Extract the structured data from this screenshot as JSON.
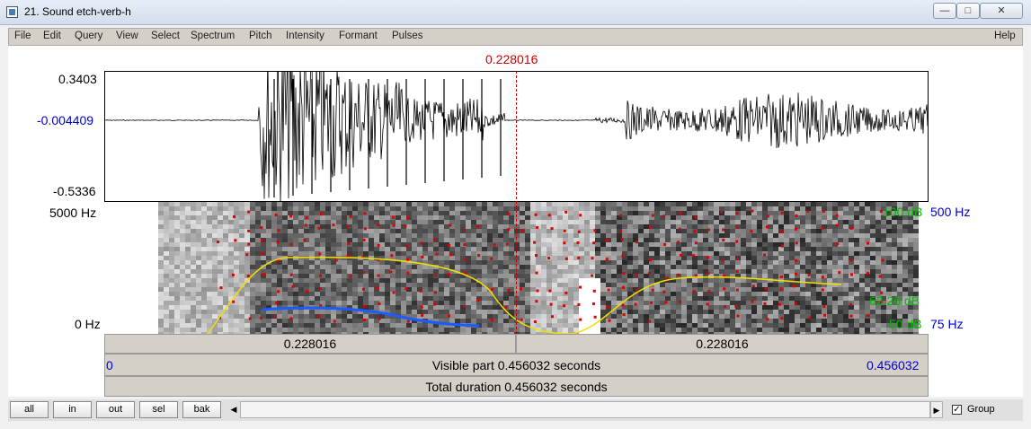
{
  "window": {
    "title": "21. Sound etch-verb-h",
    "minimize": "—",
    "maximize": "□",
    "close": "✕"
  },
  "menu": [
    "File",
    "Edit",
    "Query",
    "View",
    "Select",
    "Spectrum",
    "Pitch",
    "Intensity",
    "Formant",
    "Pulses"
  ],
  "help": "Help",
  "cursor": {
    "time_top": "0.228016",
    "left_half": "0.228016",
    "right_half": "0.228016"
  },
  "waveform": {
    "max": "0.3403",
    "center": "-0.004409",
    "min": "-0.5336"
  },
  "spectrogram": {
    "top_freq": "5000 Hz",
    "bottom_freq": "0 Hz",
    "intensity_top": "100 dB",
    "intensity_mid": "62.26 dB",
    "intensity_bottom": "50 dB",
    "pitch_top": "500 Hz",
    "pitch_bottom": "75 Hz"
  },
  "visible": {
    "start": "0",
    "label": "Visible part 0.456032 seconds",
    "end": "0.456032"
  },
  "total": {
    "label": "Total duration 0.456032 seconds"
  },
  "buttons": {
    "all": "all",
    "in": "in",
    "out": "out",
    "sel": "sel",
    "bak": "bak"
  },
  "group": {
    "label": "Group",
    "checked": true
  },
  "colors": {
    "cursor": "#cc0000",
    "axis_blue": "#0000cc",
    "intensity": "#00bb00",
    "pitch": "#1a5cff",
    "formant": "#e00000",
    "intensity_curve": "#f0e000"
  }
}
